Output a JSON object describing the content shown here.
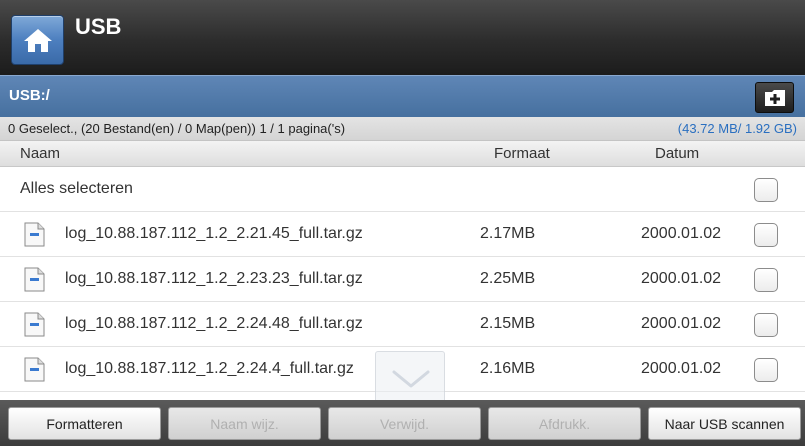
{
  "header": {
    "title": "USB",
    "home_icon": "home-icon"
  },
  "pathbar": {
    "path": "USB:/",
    "new_folder_icon": "new-folder-icon"
  },
  "info": {
    "selection_text": "0 Geselect., (20 Bestand(en) / 0 Map(pen)) 1 / 1 pagina('s)",
    "capacity_text": "(43.72 MB/ 1.92 GB)"
  },
  "columns": {
    "name": "Naam",
    "size": "Formaat",
    "date": "Datum"
  },
  "select_all": {
    "label": "Alles selecteren",
    "checked": false
  },
  "files": [
    {
      "name": "log_10.88.187.112_1.2_2.21.45_full.tar.gz",
      "size": "2.17MB",
      "date": "2000.01.02",
      "checked": false,
      "icon": "file-icon"
    },
    {
      "name": "log_10.88.187.112_1.2_2.23.23_full.tar.gz",
      "size": "2.25MB",
      "date": "2000.01.02",
      "checked": false,
      "icon": "file-icon"
    },
    {
      "name": "log_10.88.187.112_1.2_2.24.48_full.tar.gz",
      "size": "2.15MB",
      "date": "2000.01.02",
      "checked": false,
      "icon": "file-icon"
    },
    {
      "name": "log_10.88.187.112_1.2_2.24.4_full.tar.gz",
      "size": "2.16MB",
      "date": "2000.01.02",
      "checked": false,
      "icon": "file-icon"
    }
  ],
  "scroll": {
    "icon": "chevron-down-icon"
  },
  "toolbar": {
    "format_label": "Formatteren",
    "rename_label": "Naam wijz.",
    "delete_label": "Verwijd.",
    "print_label": "Afdrukk.",
    "scan_label": "Naar USB scannen"
  },
  "colors": {
    "title_bar": "#2c2c2c",
    "path_bar": "#5078a8",
    "capacity_text": "#2a6fc0",
    "home_button": "#4d7fbf"
  }
}
